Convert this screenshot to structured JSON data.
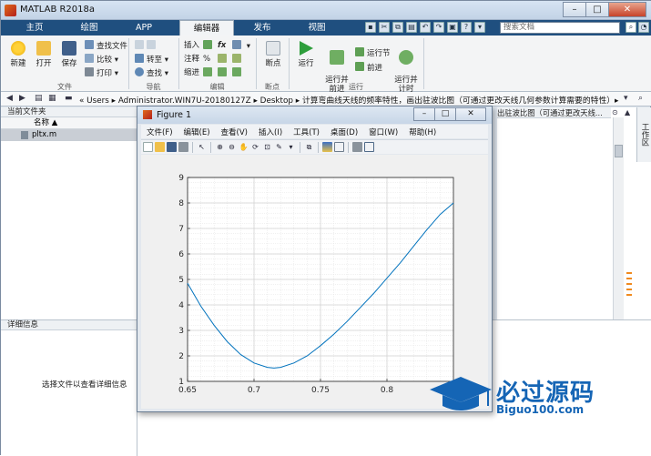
{
  "app": {
    "title": "MATLAB R2018a"
  },
  "window_controls": {
    "minimize": "–",
    "maximize": "□",
    "close": "✕"
  },
  "tabs": [
    {
      "label": "主页"
    },
    {
      "label": "绘图"
    },
    {
      "label": "APP"
    },
    {
      "label": "编辑器",
      "active": true
    },
    {
      "label": "发布"
    },
    {
      "label": "视图"
    }
  ],
  "search": {
    "placeholder": "搜索文档"
  },
  "ribbon": {
    "file": {
      "new": "新建",
      "open": "打开",
      "save": "保存",
      "find_files": "查找文件",
      "compare": "比较",
      "print": "打印",
      "group": "文件"
    },
    "navigate": {
      "goto": "转至",
      "find": "查找",
      "group": "导航"
    },
    "edit": {
      "insert": "插入",
      "comment": "注释",
      "indent": "缩进",
      "fx": "fx",
      "group": "编辑"
    },
    "breakpoints": {
      "label": "断点",
      "group": "断点"
    },
    "run": {
      "run": "运行",
      "run_advance": "运行并\n前进",
      "run_section": "运行节",
      "advance": "前进",
      "run_time": "运行并\n计时",
      "group": "运行"
    }
  },
  "address": {
    "segments": "« Users ▸ Administrator.WIN7U-20180127Z ▸ Desktop ▸ 计算弯曲线天线的频率特性，画出驻波比图（可通过更改天线几何参数计算需要的特性）▸"
  },
  "current_folder": {
    "title": "当前文件夹",
    "column_name": "名称 ▲",
    "files": [
      {
        "name": "pltx.m"
      }
    ]
  },
  "details": {
    "title": "详细信息",
    "message": "选择文件以查看详细信息"
  },
  "editor_tab": {
    "label": "出驻波比图（可通过更改天线..."
  },
  "workspace": {
    "label": "工作区"
  },
  "figure": {
    "title": "Figure 1",
    "menus": [
      "文件(F)",
      "编辑(E)",
      "查看(V)",
      "插入(I)",
      "工具(T)",
      "桌面(D)",
      "窗口(W)",
      "帮助(H)"
    ]
  },
  "chart_data": {
    "type": "line",
    "title": "",
    "xlabel": "",
    "ylabel": "",
    "xlim": [
      0.65,
      0.85
    ],
    "ylim": [
      1,
      9
    ],
    "xticks": [
      0.65,
      0.7,
      0.75,
      0.8
    ],
    "xtick_labels": [
      "0.65",
      "0.7",
      "0.75",
      "0.8"
    ],
    "yticks": [
      1,
      2,
      3,
      4,
      5,
      6,
      7,
      8,
      9
    ],
    "ytick_labels": [
      "1",
      "2",
      "3",
      "4",
      "5",
      "6",
      "7",
      "8",
      "9"
    ],
    "grid": true,
    "series": [
      {
        "color": "#0072bd",
        "x": [
          0.65,
          0.66,
          0.67,
          0.68,
          0.69,
          0.7,
          0.71,
          0.715,
          0.72,
          0.73,
          0.74,
          0.75,
          0.76,
          0.77,
          0.78,
          0.79,
          0.8,
          0.81,
          0.82,
          0.83,
          0.84,
          0.85
        ],
        "y": [
          4.85,
          3.95,
          3.2,
          2.55,
          2.05,
          1.72,
          1.55,
          1.52,
          1.55,
          1.72,
          2.0,
          2.4,
          2.85,
          3.35,
          3.9,
          4.45,
          5.05,
          5.65,
          6.3,
          6.95,
          7.55,
          8.0
        ]
      }
    ]
  },
  "watermark": {
    "text": "必过源码",
    "sub": "Biguo100.com"
  }
}
